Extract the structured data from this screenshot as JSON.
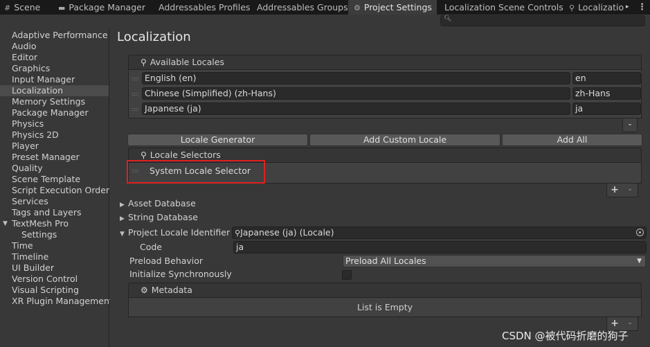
{
  "tabs": [
    {
      "label": "Scene",
      "icon": "grid-icon"
    },
    {
      "label": "Package Manager",
      "icon": "package-icon"
    },
    {
      "label": "Addressables Profiles",
      "icon": ""
    },
    {
      "label": "Addressables Groups",
      "icon": ""
    },
    {
      "label": "Project Settings",
      "icon": "gear-icon",
      "active": true
    },
    {
      "label": "Localization Scene Controls",
      "icon": ""
    },
    {
      "label": "Localizatio",
      "icon": "pin-table-icon"
    }
  ],
  "sidebar": {
    "items": [
      "Adaptive Performance",
      "Audio",
      "Editor",
      "Graphics",
      "Input Manager",
      "Localization",
      "Memory Settings",
      "Package Manager",
      "Physics",
      "Physics 2D",
      "Player",
      "Preset Manager",
      "Quality",
      "Scene Template",
      "Script Execution Order",
      "Services",
      "Tags and Layers",
      "TextMesh Pro",
      "Settings",
      "Time",
      "Timeline",
      "UI Builder",
      "Version Control",
      "Visual Scripting",
      "XR Plugin Management"
    ],
    "selected": "Localization"
  },
  "main": {
    "title": "Localization",
    "available_locales": {
      "header": "Available Locales",
      "rows": [
        {
          "name": "English (en)",
          "code": "en"
        },
        {
          "name": "Chinese (Simplified) (zh-Hans)",
          "code": "zh-Hans"
        },
        {
          "name": "Japanese (ja)",
          "code": "ja"
        }
      ],
      "remove": "-"
    },
    "buttons": {
      "generator": "Locale Generator",
      "add_custom": "Add Custom Locale",
      "add_all": "Add All"
    },
    "locale_selectors": {
      "header": "Locale Selectors",
      "items": [
        "System Locale Selector"
      ],
      "add": "+",
      "remove": "-"
    },
    "asset_database": "Asset Database",
    "string_database": "String Database",
    "project_locale": {
      "label": "Project Locale Identifier",
      "value": "Japanese (ja) (Locale)",
      "code_label": "Code",
      "code_value": "ja"
    },
    "preload": {
      "label": "Preload Behavior",
      "value": "Preload All Locales"
    },
    "init_sync": {
      "label": "Initialize Synchronously",
      "checked": false
    },
    "metadata": {
      "header": "Metadata",
      "empty": "List is Empty",
      "add": "+",
      "remove": "-"
    }
  },
  "watermark": "CSDN @被代码折磨的狗子",
  "menu_icon": "⋮",
  "tab_scroll": "▸"
}
